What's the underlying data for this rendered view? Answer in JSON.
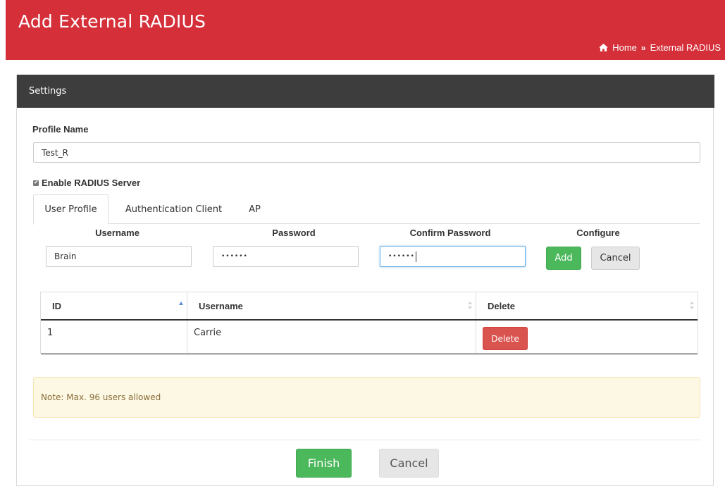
{
  "header": {
    "title": "Add External RADIUS",
    "breadcrumb": {
      "home": "Home",
      "separator": "»",
      "current": "External RADIUS"
    }
  },
  "panel": {
    "title": "Settings",
    "profile_name_label": "Profile Name",
    "profile_name_value": "Test_R",
    "enable_radius_label": "Enable RADIUS Server",
    "enable_radius_checked": true
  },
  "tabs": [
    {
      "label": "User Profile",
      "active": true
    },
    {
      "label": "Authentication Client",
      "active": false
    },
    {
      "label": "AP",
      "active": false
    }
  ],
  "form": {
    "username_label": "Username",
    "password_label": "Password",
    "confirm_password_label": "Confirm Password",
    "configure_label": "Configure",
    "username_value": "Brain",
    "password_value": "••••••",
    "confirm_password_value": "••••••",
    "add_label": "Add",
    "cancel_label": "Cancel"
  },
  "table": {
    "columns": [
      "ID",
      "Username",
      "Delete"
    ],
    "rows": [
      {
        "id": "1",
        "username": "Carrie",
        "delete_label": "Delete"
      }
    ]
  },
  "note": "Note: Max. 96 users allowed",
  "footer": {
    "finish_label": "Finish",
    "cancel_label": "Cancel"
  },
  "colors": {
    "header_red": "#d5303a",
    "panel_head": "#3d3d3d",
    "green": "#4cb85c",
    "delete_red": "#d9534f"
  }
}
